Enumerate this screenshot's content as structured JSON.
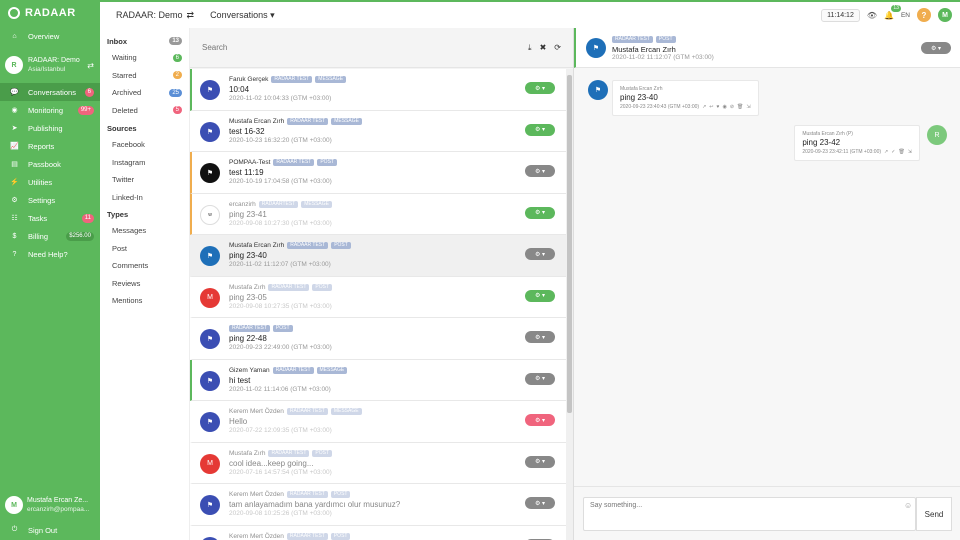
{
  "nav": {
    "brand": "RADAAR",
    "org": {
      "initial": "R",
      "name": "RADAAR: Demo",
      "timezone": "Asia/Istanbul"
    },
    "overview": "Overview",
    "items": [
      {
        "label": "Conversations",
        "badge": "6",
        "badge_color": "#f0647d",
        "icon": "comments-icon",
        "glyph": "💬"
      },
      {
        "label": "Monitoring",
        "badge": "99+",
        "badge_color": "#f0647d",
        "icon": "monitor-icon",
        "glyph": "◉"
      },
      {
        "label": "Publishing",
        "badge": "",
        "icon": "send-icon",
        "glyph": "➤"
      },
      {
        "label": "Reports",
        "badge": "",
        "icon": "chart-icon",
        "glyph": "📈"
      },
      {
        "label": "Passbook",
        "badge": "",
        "icon": "book-icon",
        "glyph": "▤"
      },
      {
        "label": "Utilities",
        "badge": "",
        "icon": "bolt-icon",
        "glyph": "⚡"
      },
      {
        "label": "Settings",
        "badge": "",
        "icon": "gear-icon",
        "glyph": "⚙"
      },
      {
        "label": "Tasks",
        "badge": "11",
        "badge_color": "#f0647d",
        "icon": "tasks-icon",
        "glyph": "☷"
      },
      {
        "label": "Billing",
        "badge": "$256.00",
        "badge_color": "#4a9d4a",
        "icon": "billing-icon",
        "glyph": "$"
      },
      {
        "label": "Need Help?",
        "badge": "",
        "icon": "help-icon",
        "glyph": "?"
      }
    ],
    "user": {
      "initial": "M",
      "name": "Mustafa Ercan Ze...",
      "email": "ercanzirh@pompaa..."
    },
    "signout": "Sign Out"
  },
  "topbar": {
    "workspace": "RADAAR: Demo",
    "section": "Conversations",
    "clock": "11:14:12",
    "notif_count": "13",
    "lang": "EN",
    "help": "?",
    "me": "M"
  },
  "filters": {
    "inbox": {
      "label": "Inbox",
      "count": "13"
    },
    "inbox_items": [
      {
        "label": "Waiting",
        "count": "6",
        "color": "#5cb85c"
      },
      {
        "label": "Starred",
        "count": "2",
        "color": "#f0ad4e"
      },
      {
        "label": "Archived",
        "count": "25",
        "color": "#5b8fd6"
      },
      {
        "label": "Deleted",
        "count": "5",
        "color": "#f0647d"
      }
    ],
    "sources_label": "Sources",
    "sources": [
      "Facebook",
      "Instagram",
      "Twitter",
      "Linked-In"
    ],
    "types_label": "Types",
    "types": [
      "Messages",
      "Post",
      "Comments",
      "Reviews",
      "Mentions"
    ]
  },
  "search": {
    "placeholder": "Search"
  },
  "conversations": [
    {
      "name": "Faruk Gerçek",
      "tags": [
        "RADAAR TEST",
        "MESSAGE"
      ],
      "msg": "10:04",
      "date": "2020-11-02 10:04:33 (GTM +03:00)",
      "avatar": "#3b4eb3",
      "initial": "",
      "btn": "#5cb85c",
      "faded": false,
      "selected": false,
      "border": "#5cb85c"
    },
    {
      "name": "Mustafa Ercan Zırh",
      "tags": [
        "RADAAR TEST",
        "MESSAGE"
      ],
      "msg": "test 16-32",
      "date": "2020-10-23 16:32:20 (GTM +03:00)",
      "avatar": "#3b4eb3",
      "initial": "",
      "btn": "#5cb85c",
      "faded": false,
      "selected": false,
      "border": "transparent"
    },
    {
      "name": "POMPAA-Test",
      "tags": [
        "RADAAR TEST",
        "POST"
      ],
      "msg": "test 11:19",
      "date": "2020-10-19 17:04:58 (GTM +03:00)",
      "avatar": "#111111",
      "initial": "",
      "btn": "#888888",
      "faded": false,
      "selected": false,
      "border": "#f0ad4e"
    },
    {
      "name": "ercanzirh",
      "tags": [
        "RADAARTEST",
        "MESSAGE"
      ],
      "msg": "ping 23-41",
      "date": "2020-09-08 10:27:30 (GTM +03:00)",
      "avatar": "#ffffff",
      "initial": "w",
      "btn": "#5cb85c",
      "faded": true,
      "selected": false,
      "border": "#f0ad4e"
    },
    {
      "name": "Mustafa Ercan Zırh",
      "tags": [
        "RADAAR TEST",
        "POST"
      ],
      "msg": "ping 23-40",
      "date": "2020-11-02 11:12:07 (GTM +03:00)",
      "avatar": "#1e6fb8",
      "initial": "",
      "btn": "#888888",
      "faded": false,
      "selected": true,
      "border": "transparent"
    },
    {
      "name": "Mustafa Zırh",
      "tags": [
        "RADAAR TEST",
        "POST"
      ],
      "msg": "ping 23-05",
      "date": "2020-09-08 10:27:35 (GTM +03:00)",
      "avatar": "#e53935",
      "initial": "M",
      "btn": "#5cb85c",
      "faded": true,
      "selected": false,
      "border": "transparent"
    },
    {
      "name": "",
      "tags": [
        "RADAAR TEST",
        "POST"
      ],
      "msg": "ping 22-48",
      "date": "2020-09-23 22:49:00 (GTM +03:00)",
      "avatar": "#3b4eb3",
      "initial": "",
      "btn": "#888888",
      "faded": false,
      "selected": false,
      "border": "transparent"
    },
    {
      "name": "Gizem Yaman",
      "tags": [
        "RADAAR TEST",
        "MESSAGE"
      ],
      "msg": "hi test",
      "date": "2020-11-02 11:14:06 (GTM +03:00)",
      "avatar": "#3b4eb3",
      "initial": "",
      "btn": "#888888",
      "faded": false,
      "selected": false,
      "border": "#5cb85c"
    },
    {
      "name": "Kerem Mert Özden",
      "tags": [
        "RADAAR TEST",
        "MESSAGE"
      ],
      "msg": "Hello",
      "date": "2020-07-22 12:09:35 (GTM +03:00)",
      "avatar": "#3b4eb3",
      "initial": "",
      "btn": "#f0647d",
      "faded": true,
      "selected": false,
      "border": "transparent"
    },
    {
      "name": "Mustafa Zırh",
      "tags": [
        "RADAAR TEST",
        "POST"
      ],
      "msg": "cool idea...keep going...",
      "date": "2020-07-16 14:57:54 (GTM +03:00)",
      "avatar": "#e53935",
      "initial": "M",
      "btn": "#888888",
      "faded": true,
      "selected": false,
      "border": "transparent"
    },
    {
      "name": "Kerem Mert Özden",
      "tags": [
        "RADAAR TEST",
        "POST"
      ],
      "msg": "tam anlayamadım bana yardımcı olur musunuz?",
      "date": "2020-09-08 10:25:26 (GTM +03:00)",
      "avatar": "#3b4eb3",
      "initial": "",
      "btn": "#888888",
      "faded": true,
      "selected": false,
      "border": "transparent"
    },
    {
      "name": "Kerem Mert Özden",
      "tags": [
        "RADAAR TEST",
        "POST"
      ],
      "msg": "",
      "date": "",
      "avatar": "#3b4eb3",
      "initial": "",
      "btn": "#888888",
      "faded": true,
      "selected": false,
      "border": "transparent"
    }
  ],
  "detail": {
    "tags": [
      "RADAAR TEST",
      "POST"
    ],
    "name": "Mustafa Ercan Zırh",
    "date": "2020-11-02 11:12:07 (GTM +03:00)",
    "incoming": {
      "author": "Mustafa Ercan Zırh",
      "text": "ping 23-40",
      "date": "2020-09-23 23:40:43 (GTM +03:00)"
    },
    "outgoing": {
      "author": "Mustafa Ercan Zırh (P)",
      "text": "ping 23-42",
      "date": "2020-09-23 23:42:11 (GTM +03:00)",
      "initial": "R"
    },
    "reply_placeholder": "Say something...",
    "send": "Send"
  }
}
